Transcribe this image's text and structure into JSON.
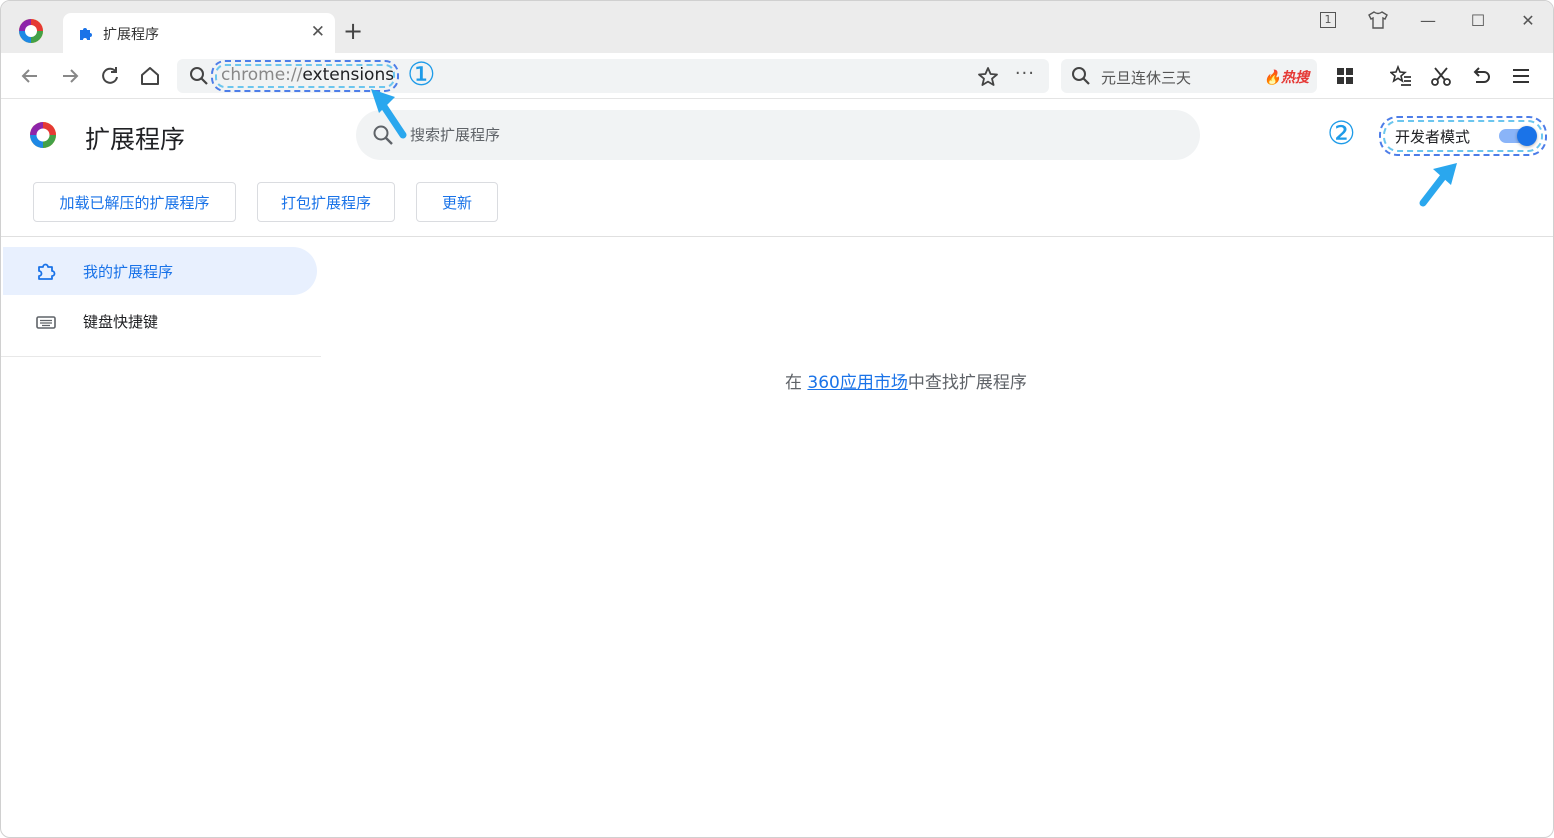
{
  "window": {
    "tab_title": "扩展程序",
    "new_tab_symbol": "+",
    "tab_close_symbol": "✕",
    "controls": {
      "tab_count": "1",
      "minimize": "—",
      "maximize": "☐",
      "close": "✕"
    }
  },
  "toolbar": {
    "url_scheme": "chrome://",
    "url_path": "extensions",
    "more_symbol": "···",
    "search_text": "元旦连休三天",
    "hot_label": "🔥热搜"
  },
  "extensions": {
    "title": "扩展程序",
    "search_placeholder": "搜索扩展程序",
    "developer_mode_label": "开发者模式",
    "developer_mode_enabled": true,
    "buttons": {
      "load_unpacked": "加载已解压的扩展程序",
      "pack": "打包扩展程序",
      "update": "更新"
    }
  },
  "sidebar": {
    "items": [
      {
        "label": "我的扩展程序",
        "icon": "puzzle-icon",
        "active": true
      },
      {
        "label": "键盘快捷键",
        "icon": "keyboard-icon",
        "active": false
      }
    ]
  },
  "main": {
    "empty_prefix": "在 ",
    "empty_link": "360应用市场",
    "empty_suffix": "中查找扩展程序"
  },
  "annotations": {
    "step1": "①",
    "step2": "②"
  },
  "colors": {
    "accent": "#1a73e8",
    "annotation_dash": "#4d7de8",
    "annotation_arrow": "#2aa7ee"
  }
}
